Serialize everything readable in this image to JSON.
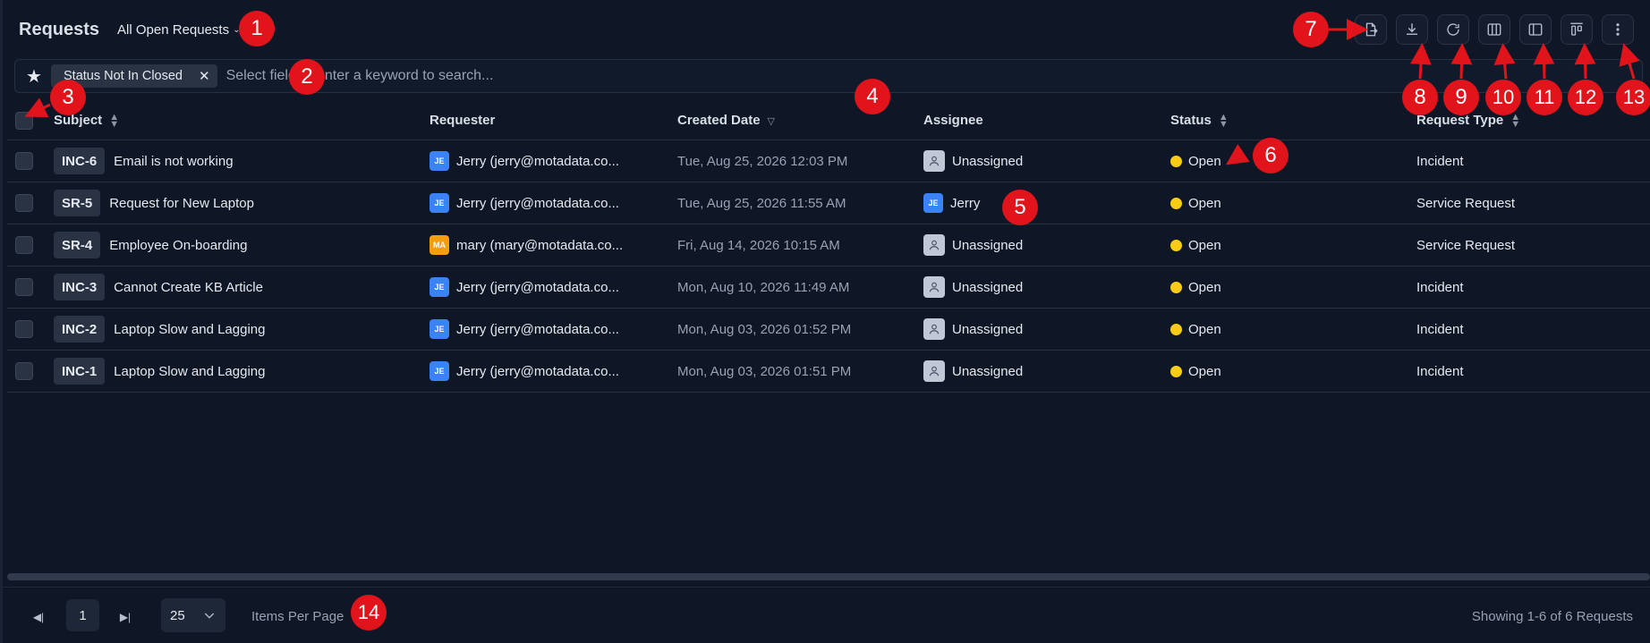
{
  "header": {
    "title": "Requests",
    "view": "All Open Requests"
  },
  "toolbar": [
    {
      "name": "export-icon"
    },
    {
      "name": "download-icon"
    },
    {
      "name": "refresh-icon"
    },
    {
      "name": "columns-icon"
    },
    {
      "name": "sidebar-panel-icon"
    },
    {
      "name": "layout-icon"
    },
    {
      "name": "more-vertical-icon"
    }
  ],
  "search": {
    "chip": "Status Not In Closed",
    "placeholder": "Select field or enter a keyword to search..."
  },
  "table": {
    "columns": [
      "Subject",
      "Requester",
      "Created Date",
      "Assignee",
      "Status",
      "Request Type"
    ],
    "rows": [
      {
        "id": "INC-6",
        "subject": "Email is not working",
        "req_initials": "JE",
        "req_color": "#3b82f6",
        "requester": "Jerry (jerry@motadata.co...",
        "date": "Tue, Aug 25, 2026 12:03 PM",
        "assignee": "Unassigned",
        "status": "Open",
        "type": "Incident"
      },
      {
        "id": "SR-5",
        "subject": "Request for New Laptop",
        "req_initials": "JE",
        "req_color": "#3b82f6",
        "requester": "Jerry (jerry@motadata.co...",
        "date": "Tue, Aug 25, 2026 11:55 AM",
        "assignee": "Jerry",
        "status": "Open",
        "type": "Service Request"
      },
      {
        "id": "SR-4",
        "subject": "Employee On-boarding",
        "req_initials": "MA",
        "req_color": "#f59e0b",
        "requester": "mary (mary@motadata.co...",
        "date": "Fri, Aug 14, 2026 10:15 AM",
        "assignee": "Unassigned",
        "status": "Open",
        "type": "Service Request"
      },
      {
        "id": "INC-3",
        "subject": "Cannot Create KB Article",
        "req_initials": "JE",
        "req_color": "#3b82f6",
        "requester": "Jerry (jerry@motadata.co...",
        "date": "Mon, Aug 10, 2026 11:49 AM",
        "assignee": "Unassigned",
        "status": "Open",
        "type": "Incident"
      },
      {
        "id": "INC-2",
        "subject": "Laptop Slow and Lagging",
        "req_initials": "JE",
        "req_color": "#3b82f6",
        "requester": "Jerry (jerry@motadata.co...",
        "date": "Mon, Aug 03, 2026 01:52 PM",
        "assignee": "Unassigned",
        "status": "Open",
        "type": "Incident"
      },
      {
        "id": "INC-1",
        "subject": "Laptop Slow and Lagging",
        "req_initials": "JE",
        "req_color": "#3b82f6",
        "requester": "Jerry (jerry@motadata.co...",
        "date": "Mon, Aug 03, 2026 01:51 PM",
        "assignee": "Unassigned",
        "status": "Open",
        "type": "Incident"
      }
    ]
  },
  "footer": {
    "page": "1",
    "per_page": "25",
    "per_page_label": "Items Per Page",
    "showing": "Showing 1-6 of 6 Requests"
  },
  "annotations": [
    "1",
    "2",
    "3",
    "4",
    "5",
    "6",
    "7",
    "8",
    "9",
    "10",
    "11",
    "12",
    "13",
    "14"
  ],
  "colors": {
    "marker": "#e1141b",
    "status_open": "#facc15",
    "background": "#0f1626"
  }
}
